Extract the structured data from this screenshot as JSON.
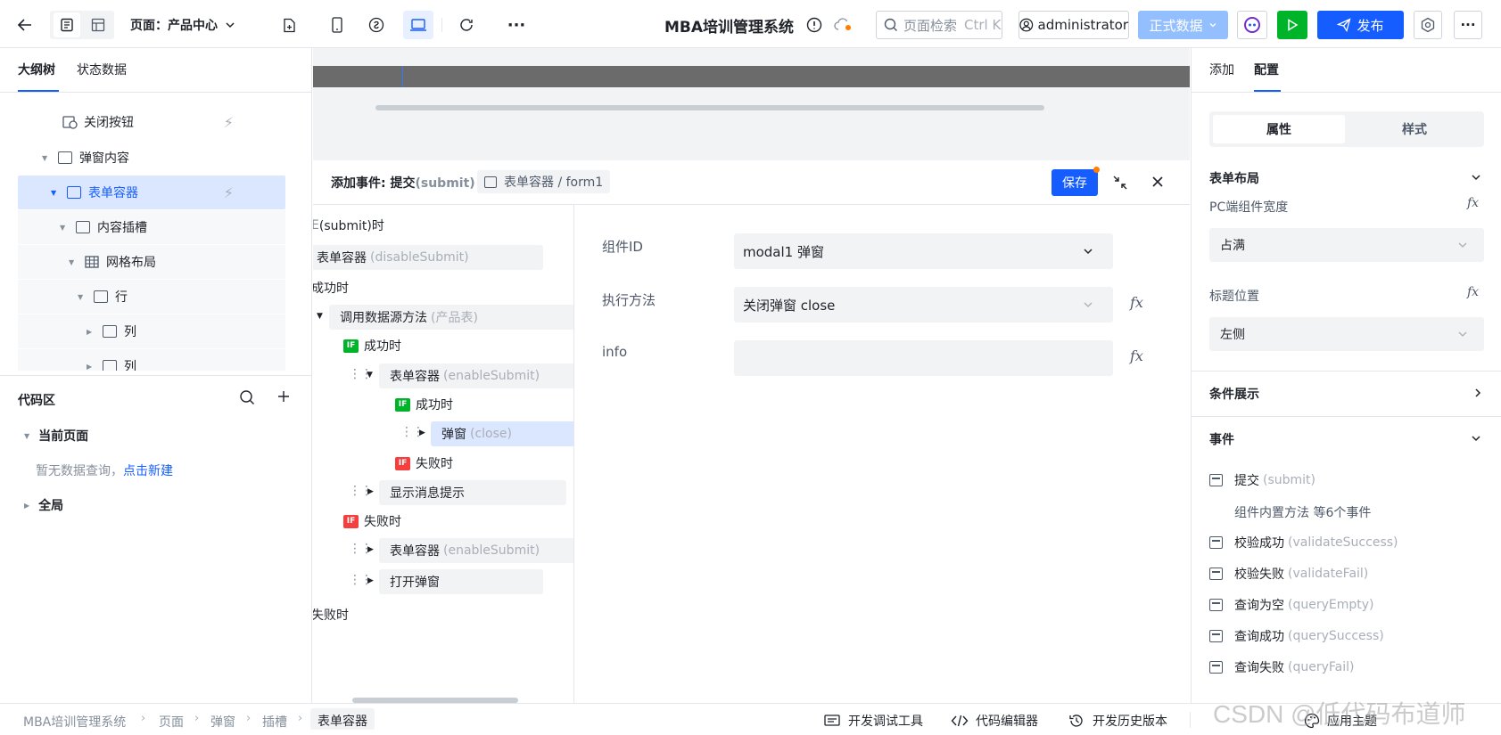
{
  "app": {
    "title": "MBA培训管理系统"
  },
  "toolbar": {
    "page_prefix": "页面：",
    "page_name": "产品中心",
    "search_placeholder": "页面检索",
    "search_shortcut": "Ctrl K",
    "user": "administrator",
    "env_label": "正式数据",
    "publish_label": "发布"
  },
  "left": {
    "tabs": [
      "大纲树",
      "状态数据"
    ],
    "tree": [
      {
        "label": "关闭按钮",
        "icon": "close-button-icon"
      },
      {
        "label": "弹窗内容",
        "icon": "modal-content-icon"
      },
      {
        "label": "表单容器",
        "icon": "form-icon"
      },
      {
        "label": "内容插槽",
        "icon": "slot-icon"
      },
      {
        "label": "网格布局",
        "icon": "grid-icon"
      },
      {
        "label": "行",
        "icon": "row-icon"
      },
      {
        "label": "列",
        "icon": "column-icon"
      },
      {
        "label": "列",
        "icon": "column-icon"
      }
    ],
    "code": {
      "title": "代码区",
      "current_page": "当前页面",
      "empty_text": "暂无数据查询，",
      "create_link": "点击新建",
      "global": "全局"
    }
  },
  "modal": {
    "title_prefix": "添加事件: 提交",
    "title_code": "(submit)",
    "path": "表单容器 / form1",
    "save": "保存"
  },
  "flow": {
    "trigger_suffix": "(submit)时",
    "n1": "表单容器",
    "n1g": "(disableSubmit)",
    "success": "成功时",
    "n2": "调用数据源方法",
    "n2g": "(产品表)",
    "if_success": "成功时",
    "n3": "表单容器",
    "n3g": "(enableSubmit)",
    "if_success2": "成功时",
    "n4": "弹窗",
    "n4g": "(close)",
    "if_fail2": "失败时",
    "n5": "显示消息提示",
    "if_fail": "失败时",
    "n6": "表单容器",
    "n6g": "(enableSubmit)",
    "n7": "打开弹窗",
    "fail": "失败时"
  },
  "form": {
    "fields": [
      {
        "label": "组件ID",
        "value": "modal1 弹窗"
      },
      {
        "label": "执行方法",
        "value": "关闭弹窗 close"
      },
      {
        "label": "info",
        "value": ""
      }
    ]
  },
  "right": {
    "tabs": [
      "添加",
      "配置"
    ],
    "seg": [
      "属性",
      "样式"
    ],
    "layout_title": "表单布局",
    "pc_width_label": "PC端组件宽度",
    "pc_width_value": "占满",
    "title_pos_label": "标题位置",
    "title_pos_value": "左侧",
    "cond_title": "条件展示",
    "events_title": "事件",
    "events": [
      {
        "name": "提交",
        "code": "(submit)"
      },
      {
        "name": "校验成功",
        "code": "(validateSuccess)"
      },
      {
        "name": "校验失败",
        "code": "(validateFail)"
      },
      {
        "name": "查询为空",
        "code": "(queryEmpty)"
      },
      {
        "name": "查询成功",
        "code": "(querySuccess)"
      },
      {
        "name": "查询失败",
        "code": "(queryFail)"
      }
    ],
    "builtin_events": "组件内置方法 等6个事件"
  },
  "bottom": {
    "crumbs": [
      "MBA培训管理系统",
      "页面",
      "弹窗",
      "插槽",
      "表单容器"
    ],
    "tools": [
      "开发调试工具",
      "代码编辑器",
      "开发历史版本",
      "应用主题"
    ],
    "watermark": "CSDN @低代码布道师"
  },
  "colors": {
    "accent": "#165dff",
    "success": "#00b42a",
    "danger": "#f53f3f",
    "run": "#00b42a"
  }
}
